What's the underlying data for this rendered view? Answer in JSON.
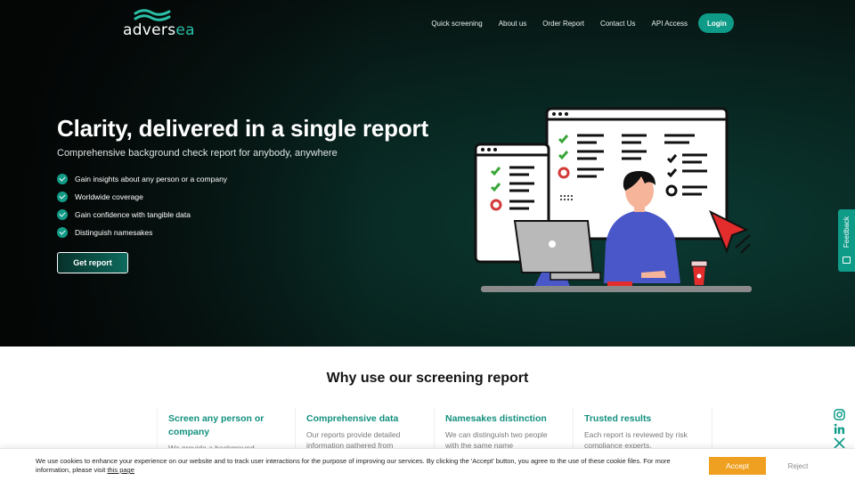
{
  "brand": {
    "name_prefix": "advers",
    "name_accent": "ea",
    "accent_color": "#2bbfa7"
  },
  "nav": {
    "items": [
      {
        "label": "Quick screening"
      },
      {
        "label": "About us"
      },
      {
        "label": "Order Report"
      },
      {
        "label": "Contact Us"
      },
      {
        "label": "API Access"
      }
    ],
    "login_label": "Login"
  },
  "hero": {
    "title": "Clarity, delivered in a single report",
    "subtitle": "Comprehensive background check report for anybody, anywhere",
    "benefits": [
      "Gain insights about any person or a company",
      "Worldwide coverage",
      "Gain confidence with tangible data",
      "Distinguish namesakes"
    ],
    "cta_label": "Get report",
    "illustration_icon": "background-check-illustration"
  },
  "feedback": {
    "label": "Feedback",
    "icon": "feedback-icon"
  },
  "why": {
    "title": "Why use our screening report",
    "features": [
      {
        "title": "Screen any person or company",
        "desc": "We provide a background"
      },
      {
        "title": "Comprehensive data",
        "desc": "Our reports provide detailed information gathered from"
      },
      {
        "title": "Namesakes distinction",
        "desc": "We can distinguish two people with the same name"
      },
      {
        "title": "Trusted results",
        "desc": "Each report is reviewed by risk compliance experts."
      }
    ]
  },
  "social": [
    "instagram-icon",
    "linkedin-icon",
    "x-icon"
  ],
  "cookie": {
    "glyph": "",
    "text": "We use cookies to enhance your experience on our website and to track user interactions for the purpose of improving our services. By clicking the 'Accept' button, you agree to the use of these cookie files. For more information, please visit ",
    "link_label": "this page",
    "accept_label": "Accept",
    "reject_label": "Reject"
  },
  "colors": {
    "primary": "#0e9b88",
    "accept": "#f0a020",
    "hero_bg": "#06100e"
  }
}
